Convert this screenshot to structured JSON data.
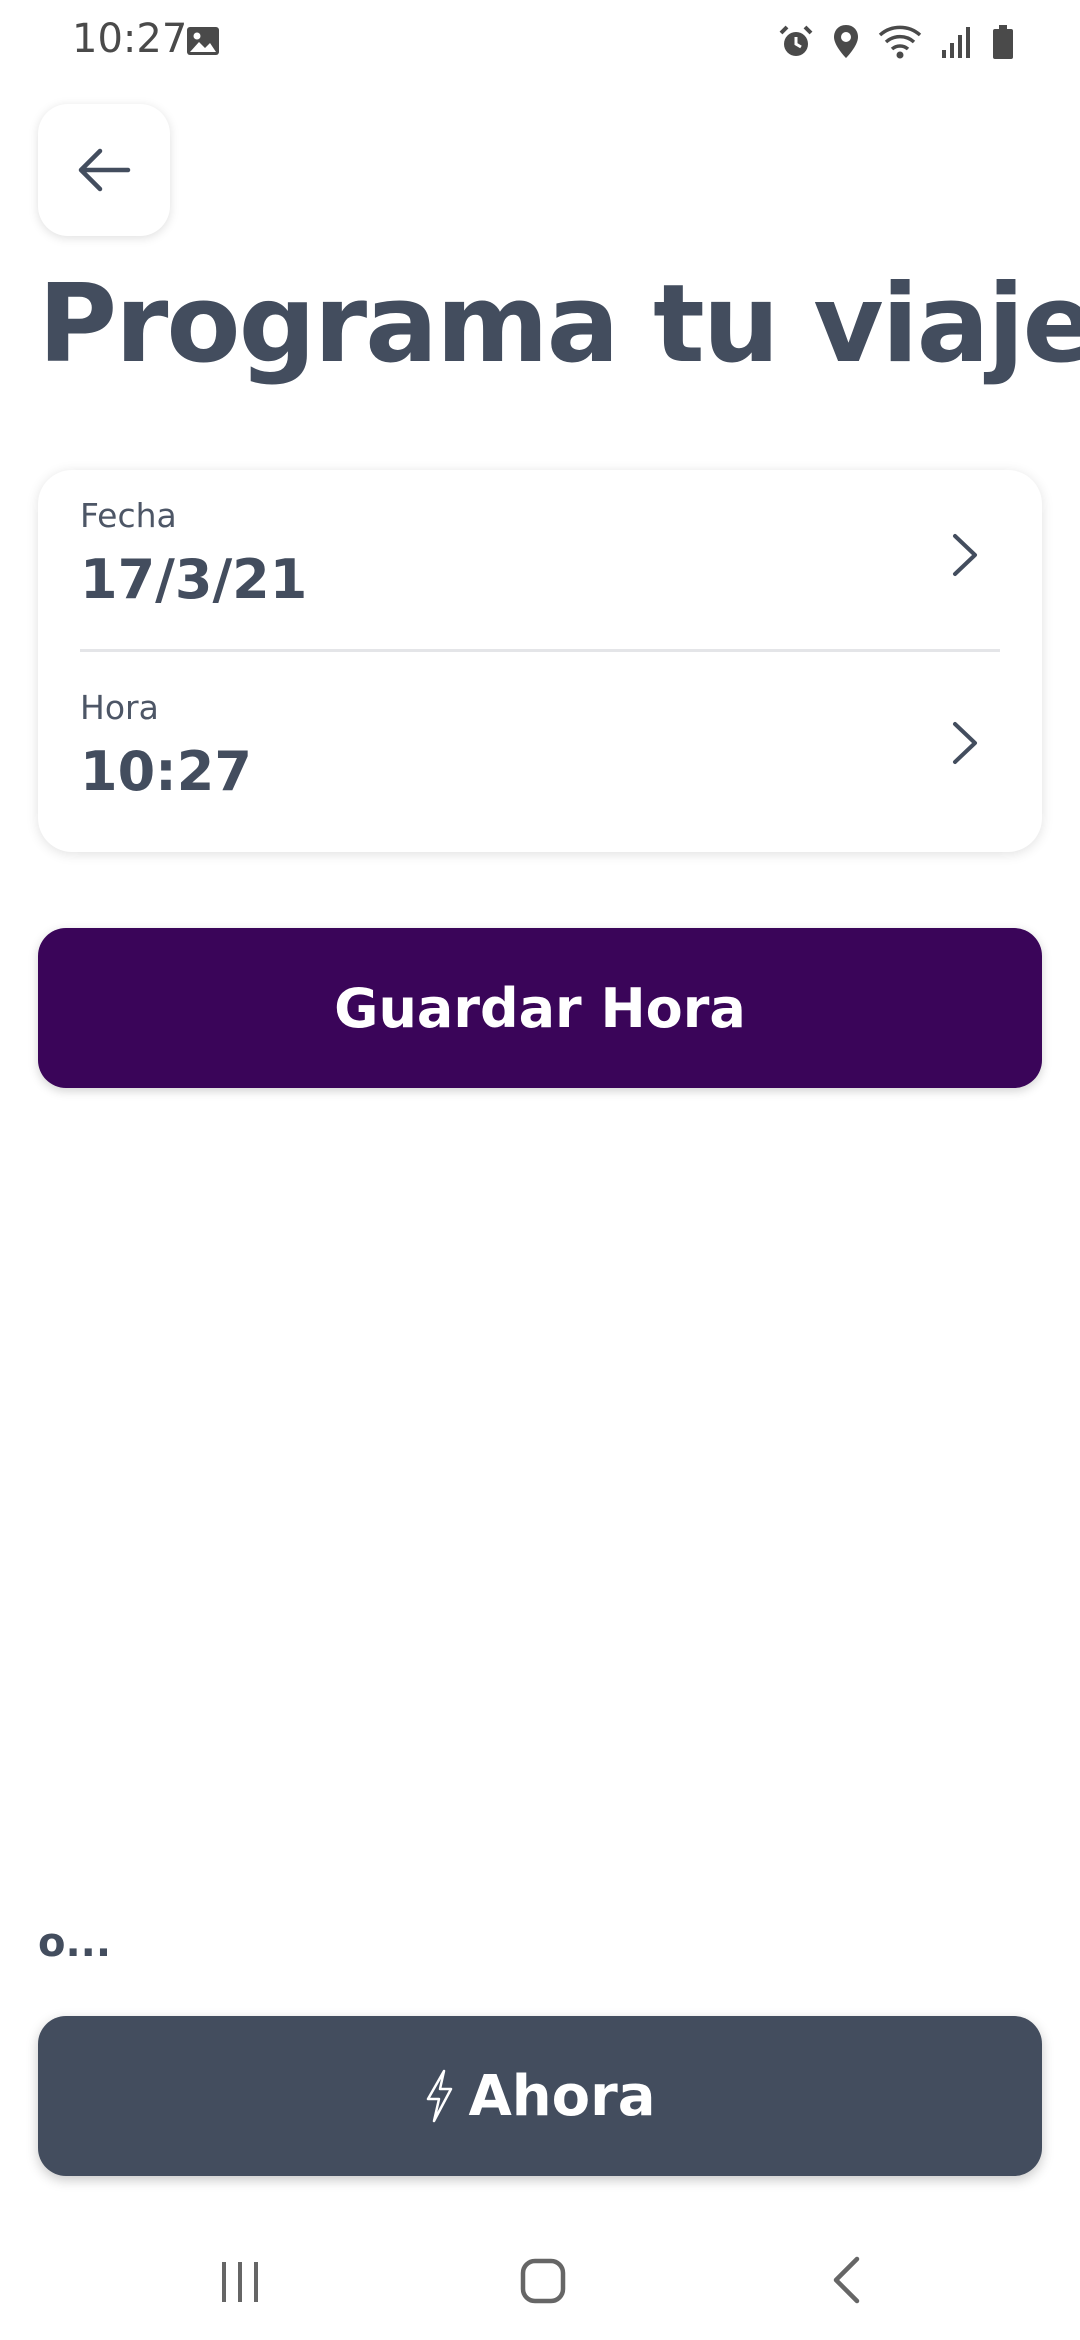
{
  "status_bar": {
    "time": "10:27",
    "icons": [
      "image-icon",
      "alarm-icon",
      "location-icon",
      "wifi-icon",
      "signal-icon",
      "battery-icon"
    ]
  },
  "header": {
    "back_icon": "arrow-left-icon",
    "title": "Programa tu viaje"
  },
  "schedule": {
    "date_label": "Fecha",
    "date_value": "17/3/21",
    "time_label": "Hora",
    "time_value": "10:27",
    "chevron_icon": "chevron-right-icon"
  },
  "actions": {
    "save_label": "Guardar Hora",
    "or_label": "o...",
    "now_label": "Ahora",
    "now_icon": "lightning-icon"
  },
  "nav_bar": {
    "icons": [
      "recent-apps-icon",
      "home-icon",
      "back-icon"
    ]
  },
  "colors": {
    "primary": "#3a0559",
    "secondary": "#434d5e",
    "text": "#434d5e",
    "background": "#ffffff"
  }
}
